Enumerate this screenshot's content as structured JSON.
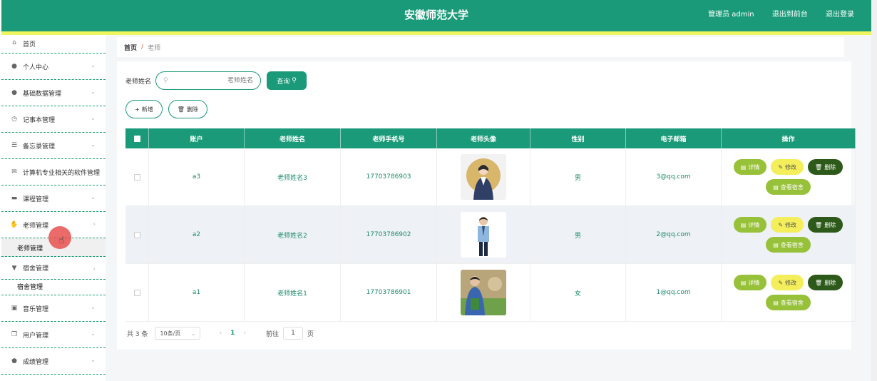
{
  "header": {
    "title": "安徽师范大学",
    "admin_label": "管理员 admin",
    "front_link": "退出到前台",
    "logout_link": "退出登录"
  },
  "sidebar": {
    "home": {
      "label": "首页",
      "icon": "home-icon"
    },
    "items": [
      {
        "label": "个人中心",
        "icon": "person-icon"
      },
      {
        "label": "基础数据管理",
        "icon": "person-icon"
      },
      {
        "label": "记事本管理",
        "icon": "clock-icon"
      },
      {
        "label": "备忘录管理",
        "icon": "sliders-icon"
      },
      {
        "label": "计算机专业相关的软件管理",
        "icon": "mail-icon"
      },
      {
        "label": "课程管理",
        "icon": "briefcase-icon"
      },
      {
        "label": "老师管理",
        "icon": "thumb-icon"
      }
    ],
    "teacher_sub": "老师管理",
    "dorm": {
      "label": "宿舍管理",
      "icon": "pin-icon"
    },
    "dorm_sub": "宿舍管理",
    "rest": [
      {
        "label": "音乐管理",
        "icon": "music-icon"
      },
      {
        "label": "用户管理",
        "icon": "copy-icon"
      },
      {
        "label": "成绩管理",
        "icon": "person-icon"
      }
    ]
  },
  "breadcrumb": {
    "home": "首页",
    "sep": "/",
    "current": "老师"
  },
  "search": {
    "label": "老师姓名",
    "placeholder": "老师姓名",
    "button": "查询"
  },
  "toolbar": {
    "add": "新增",
    "delete": "删除"
  },
  "table": {
    "headers": [
      "账户",
      "老师姓名",
      "老师手机号",
      "老师头像",
      "性别",
      "电子邮箱",
      "操作"
    ],
    "rows": [
      {
        "account": "a3",
        "name": "老师姓名3",
        "phone": "17703786903",
        "gender": "男",
        "email": "3@qq.com"
      },
      {
        "account": "a2",
        "name": "老师姓名2",
        "phone": "17703786902",
        "gender": "男",
        "email": "2@qq.com"
      },
      {
        "account": "a1",
        "name": "老师姓名1",
        "phone": "17703786901",
        "gender": "女",
        "email": "1@qq.com"
      }
    ],
    "ops": {
      "detail": "详情",
      "edit": "修改",
      "delete": "删除",
      "lookup": "查看宿舍"
    }
  },
  "pager": {
    "total": "共 3 条",
    "size": "10条/页",
    "page": "1",
    "goto_label": "前往",
    "goto_value": "1",
    "page_unit": "页"
  },
  "colors": {
    "primary": "#1a9a78",
    "stripe": "#eef55e",
    "detail": "#98c13a",
    "edit": "#f3ee5a",
    "delete": "#2d5a1a"
  }
}
